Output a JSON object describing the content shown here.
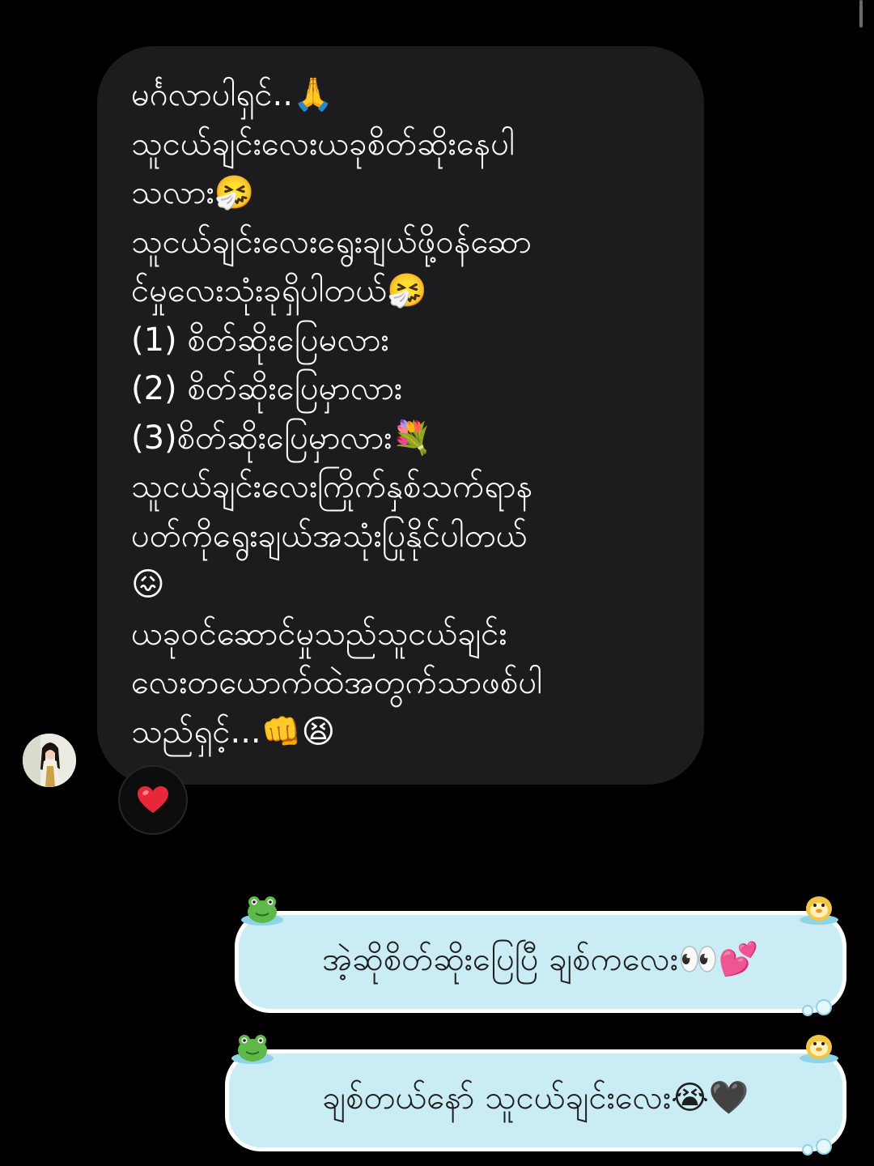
{
  "incoming_message": {
    "lines": [
      "မင်္ဂလာပါရှင်..🙏",
      "သူငယ်ချင်းလေးယခုစိတ်ဆိုးနေပါ",
      "သလား🤧",
      "သူငယ်ချင်းလေးရွေးချယ်ဖို့ဝန်ဆော",
      "င်မှုလေးသုံးခုရှိပါတယ်🤧",
      "(1) စိတ်ဆိုးပြေမလား",
      "(2) စိတ်ဆိုးပြေမှာလား",
      "(3)စိတ်ဆိုးပြေမှာလား💐",
      "သူငယ်ချင်းလေးကြိုက်နှစ်သက်ရာန",
      "ပတ်ကိုရွေးချယ်အသုံးပြုနိုင်ပါတယ်",
      "😖",
      "ယခုဝင်ဆောင်မှုသည်သူငယ်ချင်း",
      "လေးတယောက်ထဲအတွက်သာဖစ်ပါ",
      "သည်ရှင့်...👊😫"
    ],
    "reaction": "❤️",
    "avatar_icon": "profile-photo"
  },
  "outgoing_messages": [
    {
      "text": "အဲ့ဆိုစိတ်ဆိုးပြေပြီ ချစ်ကလေး👀💕"
    },
    {
      "text": "ချစ်တယ်နော် သူငယ်ချင်းလေး😭🖤"
    }
  ],
  "colors": {
    "background": "#000000",
    "incoming_bubble": "#1c1c1e",
    "sticker_bubble_fill": "#c9ecf5",
    "sticker_bubble_border": "#ffffff",
    "sticker_text": "#1e1e1e"
  }
}
